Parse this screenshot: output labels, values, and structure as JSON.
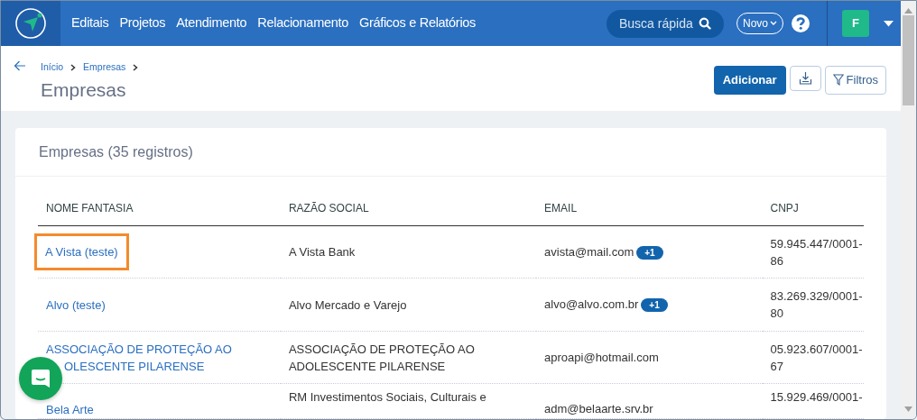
{
  "navbar": {
    "menu": [
      {
        "label": "Editais"
      },
      {
        "label": "Projetos"
      },
      {
        "label": "Atendimento"
      },
      {
        "label": "Relacionamento"
      },
      {
        "label": "Gráficos e Relatórios"
      }
    ],
    "search": {
      "placeholder": "Busca rápida"
    },
    "new_button": "Novo",
    "user_initial": "F"
  },
  "breadcrumb": [
    {
      "label": "Início"
    },
    {
      "label": "Empresas"
    }
  ],
  "page_title": "Empresas",
  "actions": {
    "add": "Adicionar",
    "filters": "Filtros"
  },
  "card_title": "Empresas (35 registros)",
  "table": {
    "columns": [
      "NOME FANTASIA",
      "RAZÃO SOCIAL",
      "EMAIL",
      "CNPJ"
    ],
    "rows": [
      {
        "name": "A Vista (teste)",
        "razao": "A Vista Bank",
        "email": "avista@mail.com",
        "extra": "+1",
        "cnpj": "59.945.447/0001-86",
        "highlighted": true
      },
      {
        "name": "Alvo (teste)",
        "razao": "Alvo Mercado e Varejo",
        "email": "alvo@alvo.com.br",
        "extra": "+1",
        "cnpj": "83.269.329/0001-80",
        "highlighted": false
      },
      {
        "name_lines": [
          "ASSOCIAÇÃO DE PROTEÇÃO AO",
          "OLESCENTE PILARENSE"
        ],
        "razao": "ASSOCIAÇÃO DE PROTEÇÃO AO ADOLESCENTE PILARENSE",
        "email": "aproapi@hotmail.com",
        "cnpj": "05.923.607/0001-67",
        "highlighted": false
      },
      {
        "name": "Bela Arte",
        "razao": "RM Investimentos Sociais, Culturais e",
        "email": "adm@belaarte.srv.br",
        "cnpj": "15.929.469/0001-",
        "highlighted": false
      }
    ]
  }
}
